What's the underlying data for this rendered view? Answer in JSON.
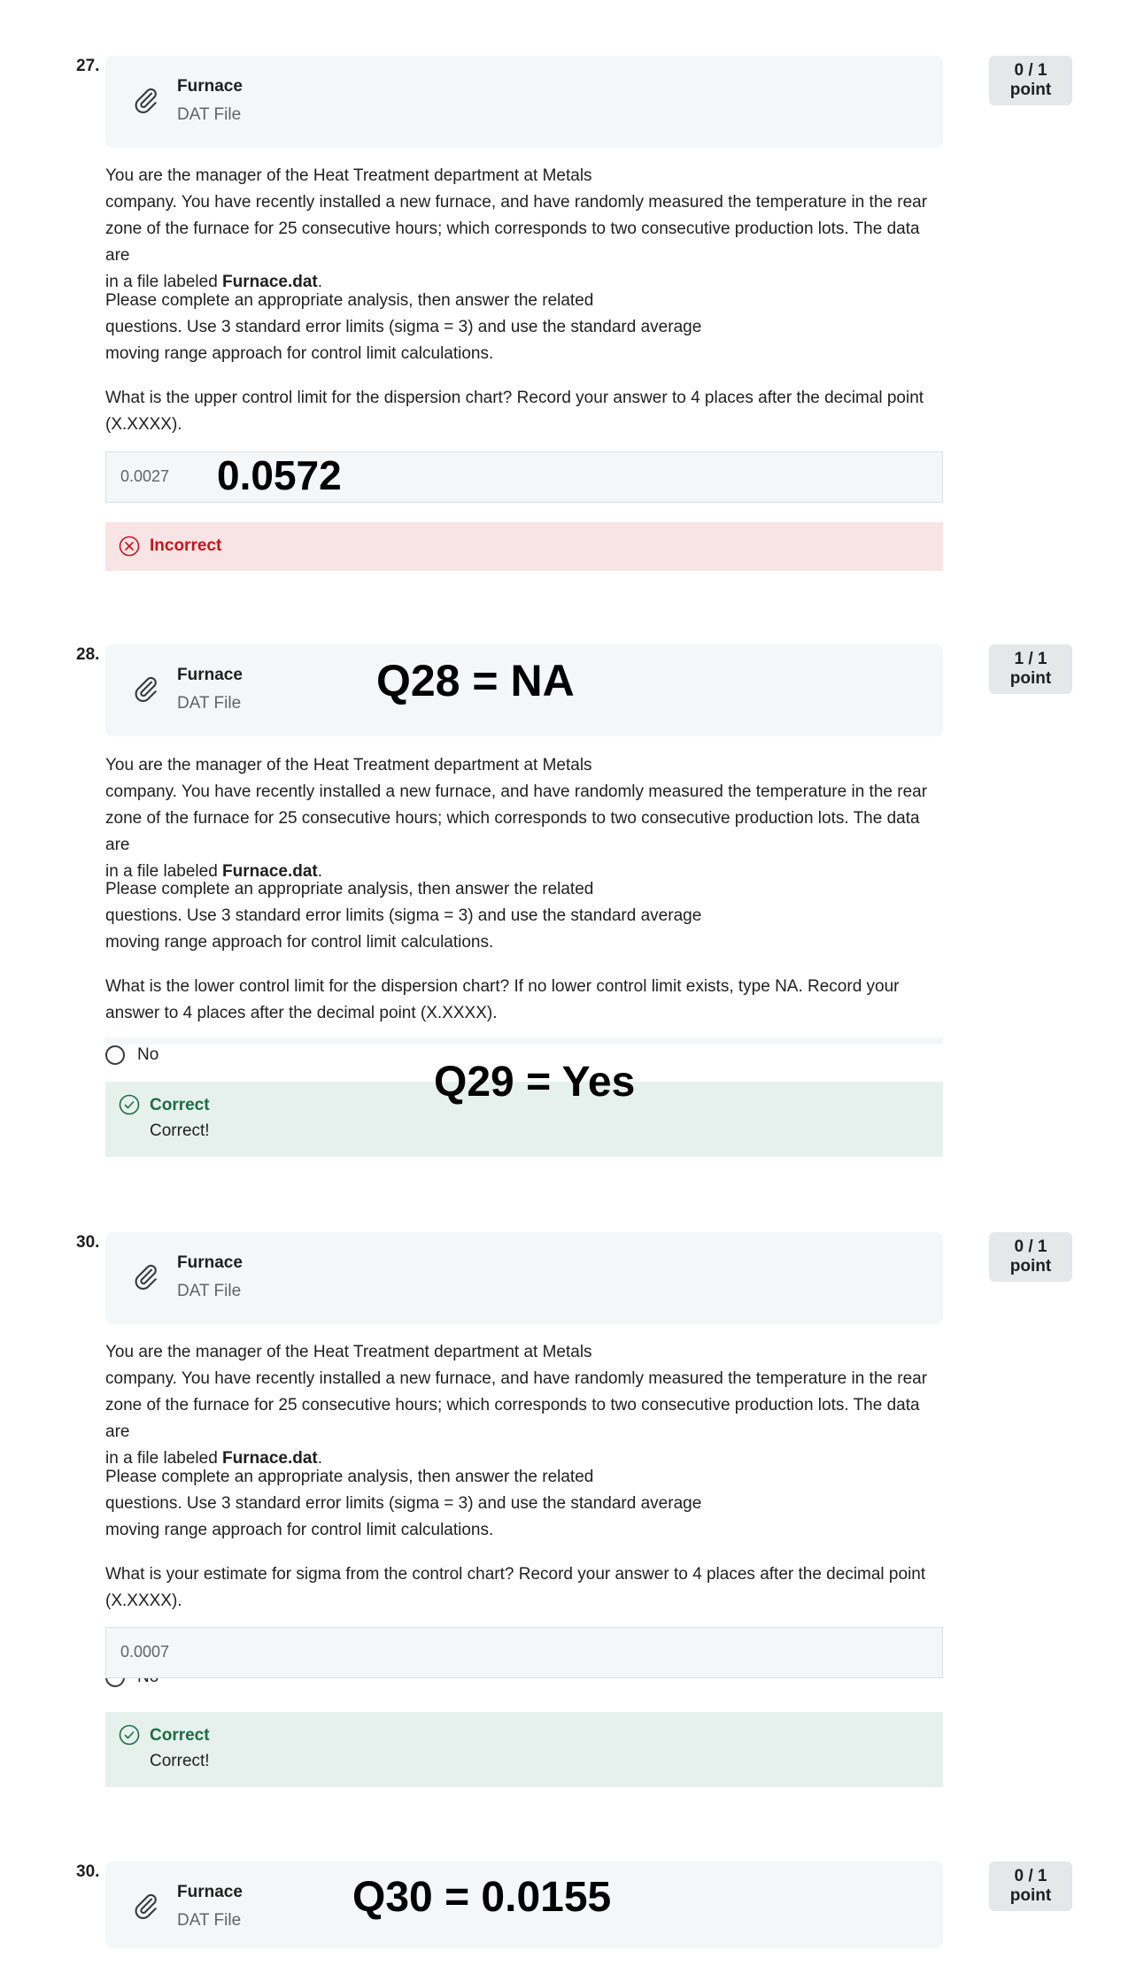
{
  "questions": [
    {
      "number": "27.",
      "points": "0 / 1 point",
      "file": {
        "name": "Furnace",
        "type": "DAT File",
        "icon": "paperclip-icon"
      },
      "intro_lines": [
        "You are the manager of the Heat Treatment department at Metals",
        "company. You have recently installed a new furnace, and have randomly measured the temperature in the rear",
        "zone of the furnace for 25 consecutive hours; which corresponds to two consecutive production lots. The data are",
        "in a file labeled "
      ],
      "intro_bold": "Furnace.dat",
      "intro_end": ".",
      "instructions_lines": [
        "Please complete an appropriate analysis, then answer the related",
        "questions. Use 3 standard error limits (sigma = 3) and use the standard average",
        "moving range approach for control limit calculations."
      ],
      "prompt_lines": [
        "What is the upper control limit for the dispersion chart? Record your answer to 4 places after the decimal point",
        "(X.XXXX)."
      ],
      "answer_value": "0.0027",
      "overlay": "0.0572",
      "feedback": {
        "status": "Incorrect",
        "color": "#c4161c"
      }
    },
    {
      "number": "28.",
      "points": "1 / 1 point",
      "file": {
        "name": "Furnace",
        "type": "DAT File",
        "icon": "paperclip-icon"
      },
      "overlay": "Q28 = NA",
      "intro_lines": [
        "You are the manager of the Heat Treatment department at Metals",
        "company. You have recently installed a new furnace, and have randomly measured the temperature in the rear",
        "zone of the furnace for 25 consecutive hours; which corresponds to two consecutive production lots. The data are",
        "in a file labeled "
      ],
      "intro_bold": "Furnace.dat",
      "intro_end": ".",
      "instructions_lines": [
        "Please complete an appropriate analysis, then answer the related",
        "questions. Use 3 standard error limits (sigma = 3) and use the standard average",
        "moving range approach for control limit calculations."
      ],
      "prompt_lines": [
        "What is the lower control limit for the dispersion chart? If no lower control limit exists, type NA. Record your",
        "answer to 4 places after the decimal point (X.XXXX)."
      ],
      "radio_label": "No",
      "overlay2": "Q29 = Yes",
      "feedback": {
        "status": "Correct",
        "message": "Correct!",
        "color": "#1e6b46"
      }
    },
    {
      "number": "30.",
      "points": "0 / 1 point",
      "file": {
        "name": "Furnace",
        "type": "DAT File",
        "icon": "paperclip-icon"
      },
      "intro_lines": [
        "You are the manager of the Heat Treatment department at Metals",
        "company. You have recently installed a new furnace, and have randomly measured the temperature in the rear",
        "zone of the furnace for 25 consecutive hours; which corresponds to two consecutive production lots. The data are",
        "in a file labeled "
      ],
      "intro_bold": "Furnace.dat",
      "intro_end": ".",
      "instructions_lines": [
        "Please complete an appropriate analysis, then answer the related",
        "questions. Use 3 standard error limits (sigma = 3) and use the standard average",
        "moving range approach for control limit calculations."
      ],
      "prompt_lines": [
        "What is your estimate for sigma from the control chart? Record your answer to 4 places after the decimal point",
        "(X.XXXX)."
      ],
      "answer_value": "0.0007",
      "radio_label": "No",
      "feedback": {
        "status": "Correct",
        "message": "Correct!",
        "color": "#1e6b46"
      }
    },
    {
      "number": "30.",
      "points": "0 / 1 point",
      "file": {
        "name": "Furnace",
        "type": "DAT File",
        "icon": "paperclip-icon"
      },
      "overlay": "Q30 = 0.0155"
    }
  ]
}
